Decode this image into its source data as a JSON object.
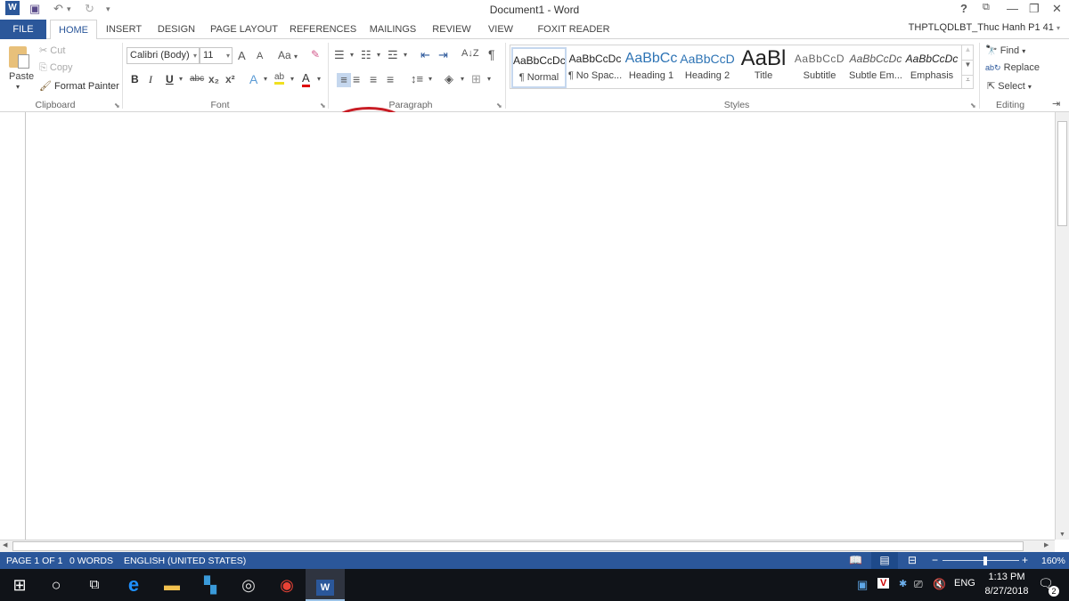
{
  "window": {
    "title": "Document1 - Word",
    "account": "THPTLQDLBT_Thuc Hanh P1 41",
    "help": "?",
    "ribbon_display": "⧉",
    "minimize": "—",
    "restore": "❐",
    "close": "✕"
  },
  "quick_access": {
    "app_icon": "W",
    "save": "💾",
    "undo": "↶",
    "undo_dropdown": "▾",
    "redo": "↻",
    "customize": "▾"
  },
  "tabs": [
    {
      "label": "FILE"
    },
    {
      "label": "HOME"
    },
    {
      "label": "INSERT"
    },
    {
      "label": "DESIGN"
    },
    {
      "label": "PAGE LAYOUT"
    },
    {
      "label": "REFERENCES"
    },
    {
      "label": "MAILINGS"
    },
    {
      "label": "REVIEW"
    },
    {
      "label": "VIEW"
    },
    {
      "label": "FOXIT READER PDF"
    }
  ],
  "clipboard": {
    "group": "Clipboard",
    "paste": "Paste",
    "cut": "Cut",
    "copy": "Copy",
    "format_painter": "Format Painter"
  },
  "font": {
    "group": "Font",
    "font_name": "Calibri (Body)",
    "font_size": "11",
    "grow": "A",
    "shrink": "A",
    "change_case": "Aa",
    "bold": "B",
    "italic": "I",
    "underline": "U",
    "strikethrough": "abc",
    "subscript": "x₂",
    "superscript": "x²",
    "text_effects": "A",
    "highlight": "ab",
    "font_color": "A"
  },
  "paragraph": {
    "group": "Paragraph",
    "show_marks": "¶",
    "sort": "A↓Z"
  },
  "styles": {
    "group": "Styles",
    "items": [
      {
        "preview": "AaBbCcDc",
        "name": "¶ Normal"
      },
      {
        "preview": "AaBbCcDc",
        "name": "¶ No Spac..."
      },
      {
        "preview": "AaBbCc",
        "name": "Heading 1"
      },
      {
        "preview": "AaBbCcD",
        "name": "Heading 2"
      },
      {
        "preview": "AaBl",
        "name": "Title"
      },
      {
        "preview": "AaBbCcD",
        "name": "Subtitle"
      },
      {
        "preview": "AaBbCcDc",
        "name": "Subtle Em..."
      },
      {
        "preview": "AaBbCcDc",
        "name": "Emphasis"
      }
    ]
  },
  "editing": {
    "group": "Editing",
    "find": "Find",
    "replace": "Replace",
    "select": "Select"
  },
  "status": {
    "page": "PAGE 1 OF 1",
    "words": "0 WORDS",
    "language": "ENGLISH (UNITED STATES)",
    "zoom": "160%",
    "zoom_minus": "−",
    "zoom_plus": "+"
  },
  "taskbar": {
    "time": "1:13 PM",
    "date": "8/27/2018",
    "lang": "ENG",
    "notifications": "2"
  },
  "colors": {
    "accent": "#2b579a",
    "annotation": "#c81d25",
    "taskbar": "#101318"
  }
}
